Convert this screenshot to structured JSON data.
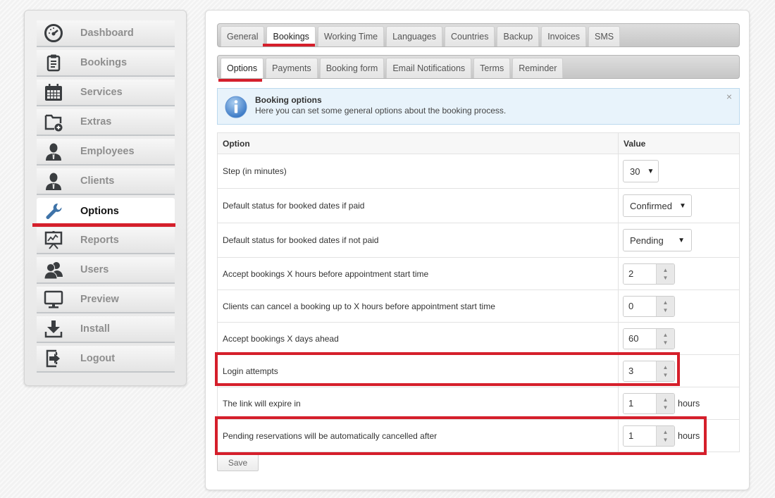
{
  "sidebar": {
    "items": [
      {
        "label": "Dashboard",
        "icon": "dashboard-gauge-icon"
      },
      {
        "label": "Bookings",
        "icon": "clipboard-icon"
      },
      {
        "label": "Services",
        "icon": "calendar-icon"
      },
      {
        "label": "Extras",
        "icon": "folder-add-icon"
      },
      {
        "label": "Employees",
        "icon": "person-icon"
      },
      {
        "label": "Clients",
        "icon": "person-icon"
      },
      {
        "label": "Options",
        "icon": "wrench-icon",
        "active": true
      },
      {
        "label": "Reports",
        "icon": "presentation-chart-icon"
      },
      {
        "label": "Users",
        "icon": "users-icon"
      },
      {
        "label": "Preview",
        "icon": "monitor-icon"
      },
      {
        "label": "Install",
        "icon": "download-icon"
      },
      {
        "label": "Logout",
        "icon": "logout-icon"
      }
    ]
  },
  "tabs": {
    "primary": [
      "General",
      "Bookings",
      "Working Time",
      "Languages",
      "Countries",
      "Backup",
      "Invoices",
      "SMS"
    ],
    "primary_active": "Bookings",
    "secondary": [
      "Options",
      "Payments",
      "Booking form",
      "Email Notifications",
      "Terms",
      "Reminder"
    ],
    "secondary_active": "Options"
  },
  "info": {
    "title": "Booking options",
    "text": "Here you can set some general options about the booking process.",
    "close": "×"
  },
  "table": {
    "headers": {
      "option": "Option",
      "value": "Value"
    },
    "rows": [
      {
        "label": "Step (in minutes)",
        "type": "select",
        "value": "30"
      },
      {
        "label": "Default status for booked dates if paid",
        "type": "select",
        "value": "Confirmed"
      },
      {
        "label": "Default status for booked dates if not paid",
        "type": "select",
        "value": "Pending"
      },
      {
        "label": "Accept bookings X hours before appointment start time",
        "type": "spinner",
        "value": "2"
      },
      {
        "label": "Clients can cancel a booking up to X hours before appointment start time",
        "type": "spinner",
        "value": "0"
      },
      {
        "label": "Accept bookings X days ahead",
        "type": "spinner",
        "value": "60"
      },
      {
        "label": "Login attempts",
        "type": "spinner",
        "value": "3",
        "highlighted": true
      },
      {
        "label": "The link will expire in",
        "type": "spinner",
        "value": "1",
        "unit": "hours"
      },
      {
        "label": "Pending reservations will be automatically cancelled after",
        "type": "spinner",
        "value": "1",
        "unit": "hours",
        "highlighted": true
      }
    ]
  },
  "actions": {
    "save_label": "Save"
  },
  "colors": {
    "accent_red": "#d51f2b",
    "info_bg": "#e8f3fb",
    "icon_dark": "#3a3d40",
    "wrench_blue": "#3e73a8"
  }
}
